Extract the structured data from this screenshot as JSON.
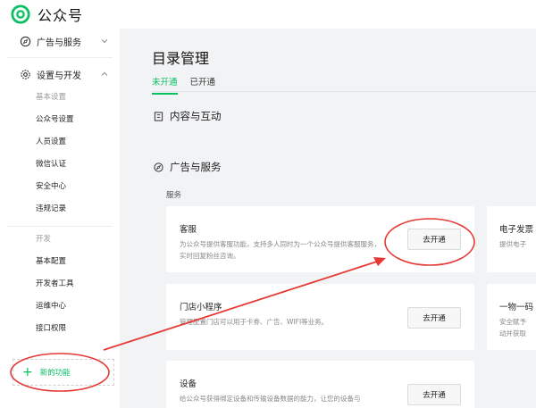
{
  "app": {
    "brand": "公众号"
  },
  "sidebar": {
    "ads_group": "广告与服务",
    "settings_group": "设置与开发",
    "basic_category": "基本设置",
    "basic_items": [
      "公众号设置",
      "人员设置",
      "微信认证",
      "安全中心",
      "违规记录"
    ],
    "dev_category": "开发",
    "dev_items": [
      "基本配置",
      "开发者工具",
      "运维中心",
      "接口权限"
    ],
    "new_feature": "新的功能"
  },
  "main": {
    "title": "目录管理",
    "tabs": [
      "未开通",
      "已开通"
    ],
    "section_content": "内容与互动",
    "section_ads": "广告与服务",
    "subhead": "服务",
    "cards": [
      {
        "title": "客服",
        "desc": "为公众号提供客服功能，支持多人同时为一个公众号提供客服服务，实时回复粉丝咨询。",
        "button": "去开通"
      },
      {
        "title": "门店小程序",
        "desc": "管理配置门店可以用于卡券、广告、WIFI等业务。",
        "button": "去开通"
      },
      {
        "title": "设备",
        "desc": "给公众号获得绑定设备和传输设备数据的能力，让您的设备与",
        "button": "去开通"
      }
    ],
    "side_cards": [
      {
        "title": "电子发票",
        "desc": "提供电子"
      },
      {
        "title": "一物一码",
        "desc1": "安全赋予",
        "desc2": "动并获取"
      }
    ]
  },
  "colors": {
    "accent": "#07c160",
    "annotation": "#e53935"
  }
}
